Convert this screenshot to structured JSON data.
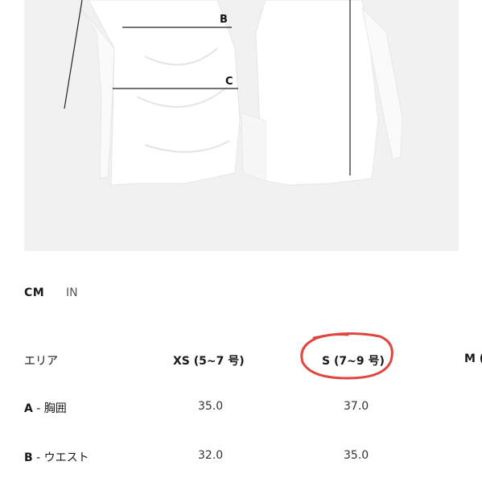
{
  "image": {
    "measure_labels": [
      "B",
      "C"
    ]
  },
  "units": {
    "cm": "CM",
    "in": "IN"
  },
  "table": {
    "headers": [
      "エリア",
      "XS (5~7 号)",
      "S (7~9 号)",
      "M ("
    ],
    "rows": [
      {
        "letter": "A",
        "label": " - 胸囲",
        "values": [
          "35.0",
          "37.0"
        ]
      },
      {
        "letter": "B",
        "label": " - ウエスト",
        "values": [
          "32.0",
          "35.0"
        ]
      }
    ]
  },
  "colors": {
    "highlight": "#e0463f",
    "photo_bg": "#f1f1f1"
  }
}
